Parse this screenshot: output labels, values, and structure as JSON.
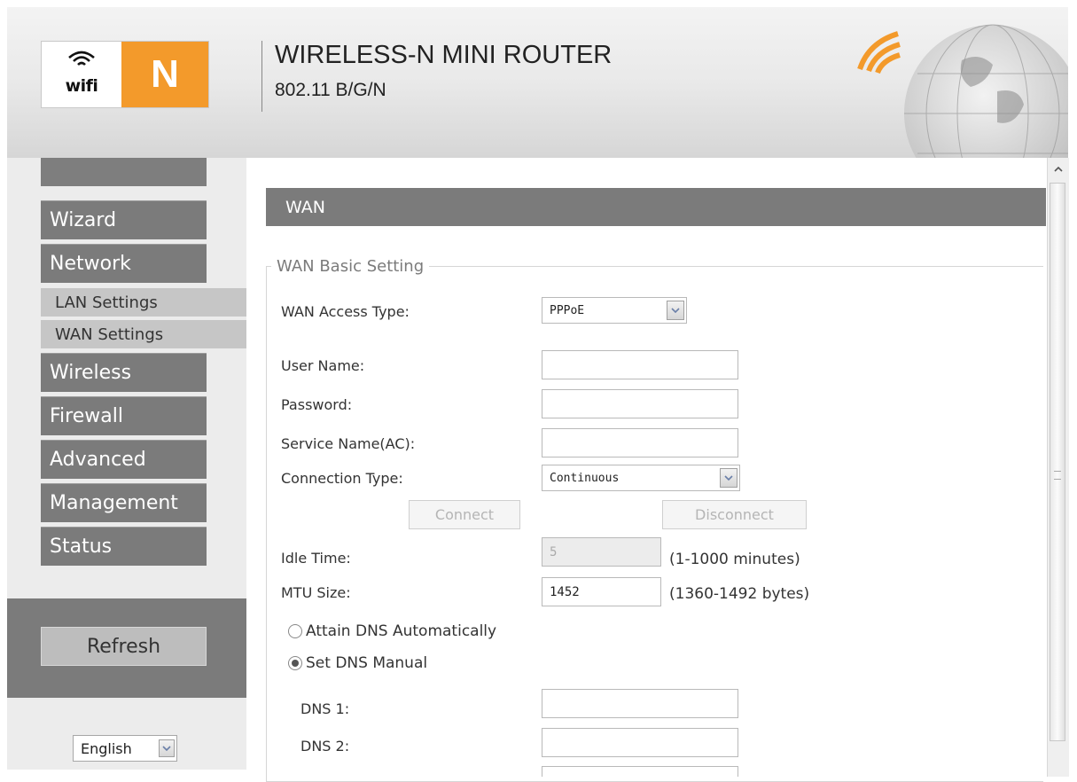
{
  "header": {
    "logo_wifi": "wifi",
    "logo_letter": "N",
    "title": "WIRELESS-N MINI ROUTER",
    "subtitle": "802.11 B/G/N"
  },
  "sidebar": {
    "items": [
      {
        "label": "Wizard"
      },
      {
        "label": "Network"
      },
      {
        "label": "LAN Settings"
      },
      {
        "label": "WAN Settings"
      },
      {
        "label": "Wireless"
      },
      {
        "label": "Firewall"
      },
      {
        "label": "Advanced"
      },
      {
        "label": "Management"
      },
      {
        "label": "Status"
      }
    ],
    "refresh_label": "Refresh",
    "language": "English"
  },
  "main": {
    "section_title": "WAN",
    "legend": "WAN Basic Setting",
    "fields": {
      "wan_access_type": {
        "label": "WAN Access Type:",
        "value": "PPPoE"
      },
      "user_name": {
        "label": "User Name:",
        "value": ""
      },
      "password": {
        "label": "Password:",
        "value": ""
      },
      "service_name": {
        "label": "Service Name(AC):",
        "value": ""
      },
      "connection_type": {
        "label": "Connection Type:",
        "value": "Continuous"
      },
      "idle_time": {
        "label": "Idle Time:",
        "value": "5",
        "hint": "(1-1000 minutes)"
      },
      "mtu_size": {
        "label": "MTU Size:",
        "value": "1452",
        "hint": "(1360-1492 bytes)"
      },
      "dns1": {
        "label": "DNS 1:",
        "value": ""
      },
      "dns2": {
        "label": "DNS 2:",
        "value": ""
      }
    },
    "connect_label": "Connect",
    "disconnect_label": "Disconnect",
    "dns_auto_label": "Attain DNS Automatically",
    "dns_manual_label": "Set DNS Manual",
    "dns_mode_selected": "manual"
  },
  "colors": {
    "menu_bg": "#7b7b7b",
    "submenu_bg": "#c6c6c6",
    "logo_orange": "#f39a2b"
  }
}
